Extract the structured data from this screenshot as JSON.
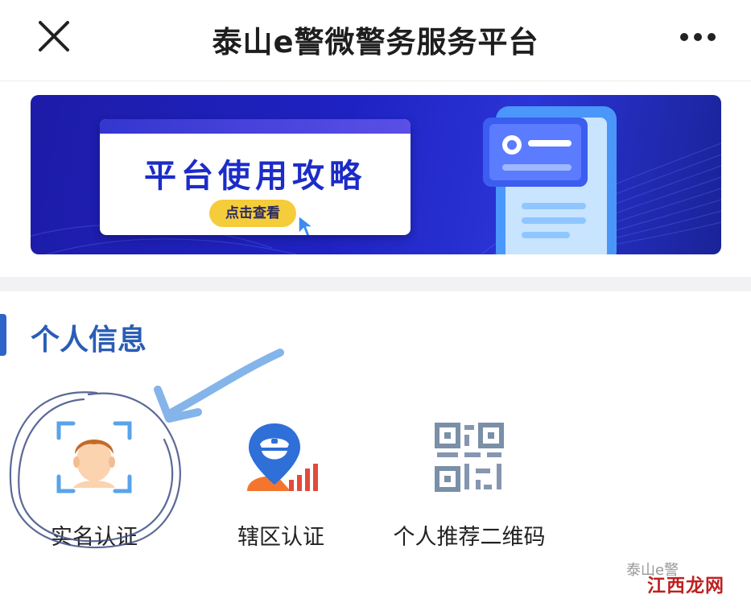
{
  "header": {
    "title": "泰山e警微警务服务平台"
  },
  "banner": {
    "headline": "平台使用攻略",
    "cta_label": "点击查看"
  },
  "section": {
    "title": "个人信息",
    "tiles": [
      {
        "label": "实名认证",
        "icon": "face-scan-icon"
      },
      {
        "label": "辖区认证",
        "icon": "police-location-icon"
      },
      {
        "label": "个人推荐二维码",
        "icon": "qr-code-icon"
      }
    ]
  },
  "watermark": {
    "text": "江西龙网",
    "under_text": "泰山e警"
  },
  "colors": {
    "banner_bg": "#1f22c2",
    "section_accent": "#2e64c9",
    "cta_yellow": "#f5cc3a"
  }
}
